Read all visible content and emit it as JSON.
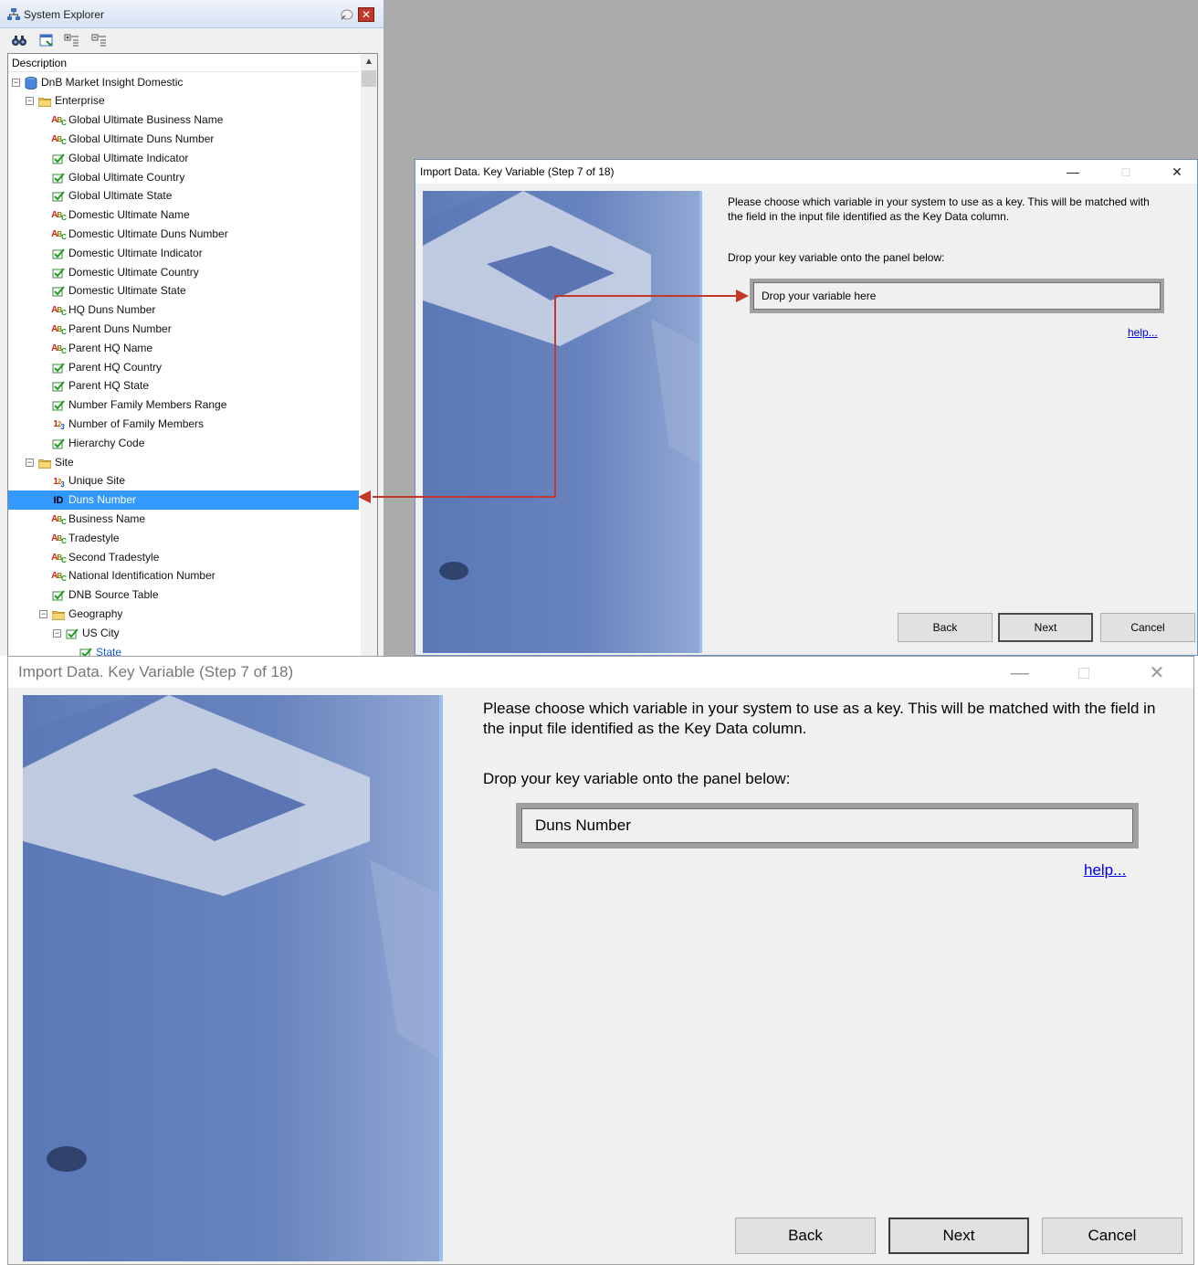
{
  "explorer": {
    "title": "System Explorer",
    "close_glyph": "✕",
    "column_header": "Description",
    "tree": [
      {
        "label": "DnB Market Insight Domestic",
        "icon": "database-icon",
        "level": 0,
        "expander": "minus"
      },
      {
        "label": "Enterprise",
        "icon": "folder-icon",
        "level": 1,
        "expander": "minus"
      },
      {
        "label": "Global Ultimate Business Name",
        "icon": "text-variable-icon",
        "level": 2
      },
      {
        "label": "Global Ultimate Duns Number",
        "icon": "text-variable-icon",
        "level": 2
      },
      {
        "label": "Global Ultimate Indicator",
        "icon": "category-variable-icon",
        "level": 2
      },
      {
        "label": "Global Ultimate Country",
        "icon": "category-variable-icon",
        "level": 2
      },
      {
        "label": "Global Ultimate State",
        "icon": "category-variable-icon",
        "level": 2
      },
      {
        "label": "Domestic Ultimate Name",
        "icon": "text-variable-icon",
        "level": 2
      },
      {
        "label": "Domestic Ultimate Duns Number",
        "icon": "text-variable-icon",
        "level": 2
      },
      {
        "label": "Domestic Ultimate Indicator",
        "icon": "category-variable-icon",
        "level": 2
      },
      {
        "label": "Domestic Ultimate Country",
        "icon": "category-variable-icon",
        "level": 2
      },
      {
        "label": "Domestic Ultimate State",
        "icon": "category-variable-icon",
        "level": 2
      },
      {
        "label": "HQ Duns Number",
        "icon": "text-variable-icon",
        "level": 2
      },
      {
        "label": "Parent Duns Number",
        "icon": "text-variable-icon",
        "level": 2
      },
      {
        "label": "Parent HQ Name",
        "icon": "text-variable-icon",
        "level": 2
      },
      {
        "label": "Parent HQ Country",
        "icon": "category-variable-icon",
        "level": 2
      },
      {
        "label": "Parent HQ State",
        "icon": "category-variable-icon",
        "level": 2
      },
      {
        "label": "Number Family Members Range",
        "icon": "category-variable-icon",
        "level": 2
      },
      {
        "label": "Number of Family Members",
        "icon": "numeric-variable-icon",
        "level": 2
      },
      {
        "label": "Hierarchy Code",
        "icon": "category-variable-icon",
        "level": 2
      },
      {
        "label": "Site",
        "icon": "folder-icon",
        "level": 1,
        "expander": "minus"
      },
      {
        "label": "Unique Site",
        "icon": "numeric-variable-icon",
        "level": 2
      },
      {
        "label": "Duns Number",
        "icon": "id-variable-icon",
        "level": 2,
        "selected": true
      },
      {
        "label": "Business Name",
        "icon": "text-variable-icon",
        "level": 2
      },
      {
        "label": "Tradestyle",
        "icon": "text-variable-icon",
        "level": 2
      },
      {
        "label": "Second Tradestyle",
        "icon": "text-variable-icon",
        "level": 2
      },
      {
        "label": "National Identification Number",
        "icon": "text-variable-icon",
        "level": 2
      },
      {
        "label": "DNB Source Table",
        "icon": "category-variable-icon",
        "level": 2
      },
      {
        "label": "Geography",
        "icon": "folder-icon",
        "level": 2,
        "expander": "minus"
      },
      {
        "label": "US City",
        "icon": "category-variable-icon",
        "level": 3,
        "expander": "minus"
      },
      {
        "label": "State",
        "icon": "category-variable-icon",
        "level": 4,
        "link": true
      }
    ]
  },
  "dialog_small": {
    "title": "Import Data.  Key Variable (Step 7 of 18)",
    "minimize_glyph": "—",
    "maximize_glyph": "□",
    "close_glyph": "✕",
    "instruction": "Please choose which variable in your system to use as a key. This will be matched with the field in the input file identified as the Key Data column.",
    "drop_prompt": "Drop your key variable onto the panel below:",
    "drop_value": "Drop your variable here",
    "help_link": "help...",
    "back_label": "Back",
    "next_label": "Next",
    "cancel_label": "Cancel"
  },
  "dialog_large": {
    "title": "Import Data.  Key Variable (Step 7 of 18)",
    "minimize_glyph": "—",
    "maximize_glyph": "□",
    "close_glyph": "✕",
    "instruction": "Please choose which variable in your system to use as a key. This will be matched with the field in the input file identified as the Key Data column.",
    "drop_prompt": "Drop your key variable onto the panel below:",
    "drop_value": "Duns Number",
    "help_link": "help...",
    "back_label": "Back",
    "next_label": "Next",
    "cancel_label": "Cancel"
  },
  "colors": {
    "selection": "#3399ff",
    "arrow": "#c0392b",
    "workspace": "#ababab",
    "link": "#0000ee"
  }
}
